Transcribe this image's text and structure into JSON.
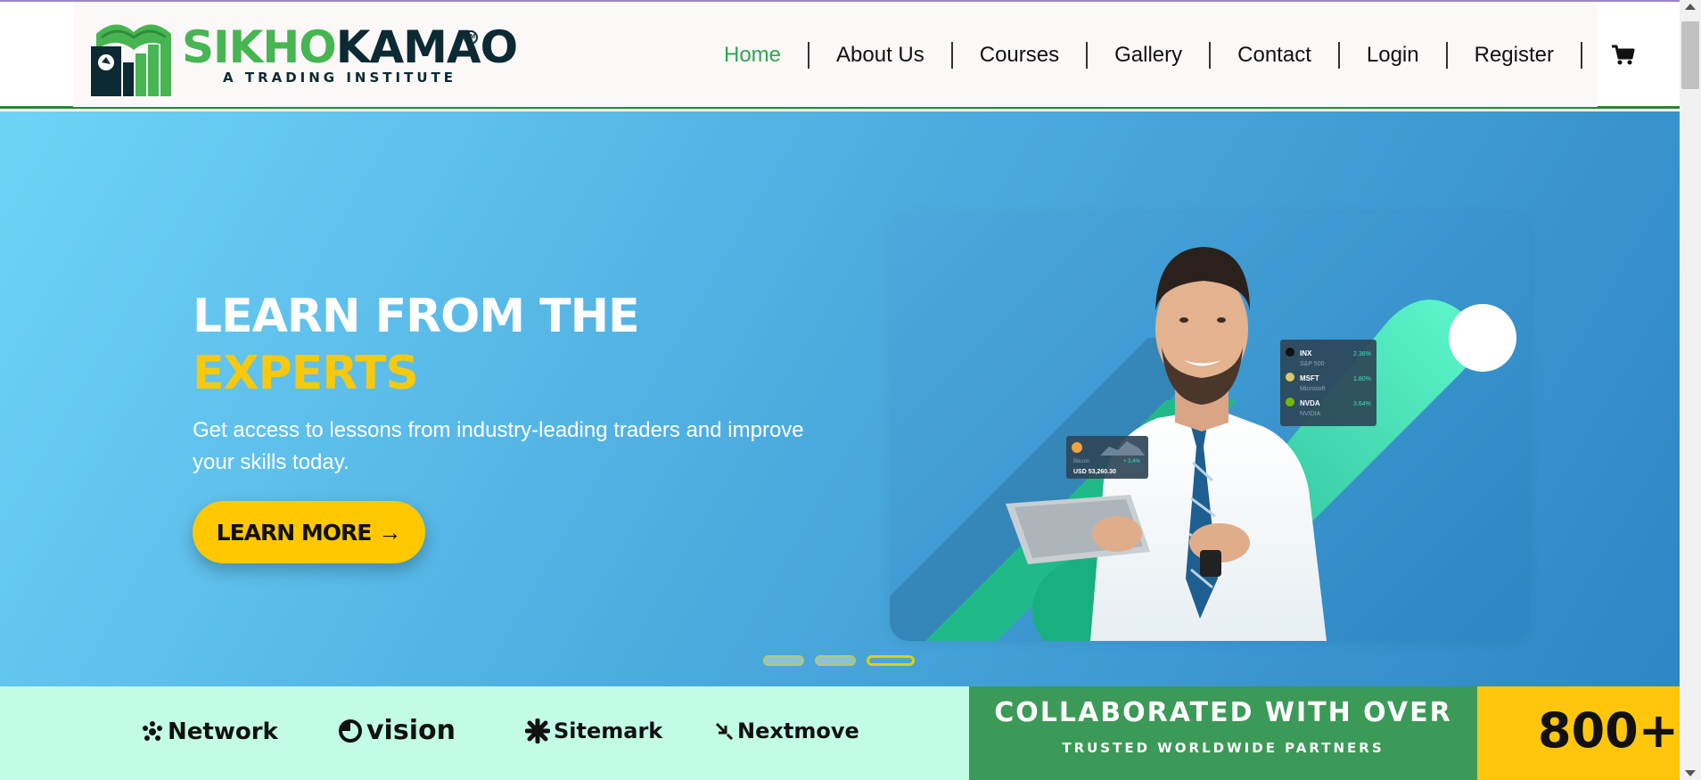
{
  "brand": {
    "name_part1": "SIKHO",
    "name_part2": "KAMAO",
    "tagline": "A TRADING INSTITUTE",
    "trademark": "TM",
    "green": "#46b552",
    "dark": "#0c2a33"
  },
  "nav": {
    "items": [
      {
        "label": "Home",
        "active": true
      },
      {
        "label": "About Us"
      },
      {
        "label": "Courses"
      },
      {
        "label": "Gallery"
      },
      {
        "label": "Contact"
      },
      {
        "label": "Login"
      },
      {
        "label": "Register"
      }
    ],
    "cart_icon": "cart-icon",
    "active_color": "#2fa64f"
  },
  "hero": {
    "title_line1": "LEARN FROM THE",
    "title_line2": "EXPERTS",
    "subtitle": "Get access to lessons from industry-leading traders and improve your skills today.",
    "button_label": "LEARN MORE",
    "button_icon": "arrow-right-icon",
    "accent": "#f6c90e",
    "ticker": [
      {
        "symbol": "INX",
        "name": "S&P 500",
        "change": "2.36%"
      },
      {
        "symbol": "MSFT",
        "name": "Microsoft",
        "change": "1.80%"
      },
      {
        "symbol": "NVDA",
        "name": "NVIDIA",
        "change": "3.64%"
      }
    ],
    "btc": {
      "label": "Bitcoin",
      "price": "USD 53,260.30",
      "change": "+ 3.4%"
    },
    "slides": {
      "count": 3,
      "active": 3
    }
  },
  "partners": {
    "items": [
      {
        "label": "Network",
        "icon": "network-icon"
      },
      {
        "label": "vision",
        "icon": "vision-icon"
      },
      {
        "label": "Sitemark",
        "icon": "sitemark-icon"
      },
      {
        "label": "Nextmove",
        "icon": "nextmove-icon"
      }
    ]
  },
  "collab": {
    "title": "COLLABORATED WITH OVER",
    "subtitle": "TRUSTED WORLDWIDE PARTNERS",
    "count": "800+"
  }
}
